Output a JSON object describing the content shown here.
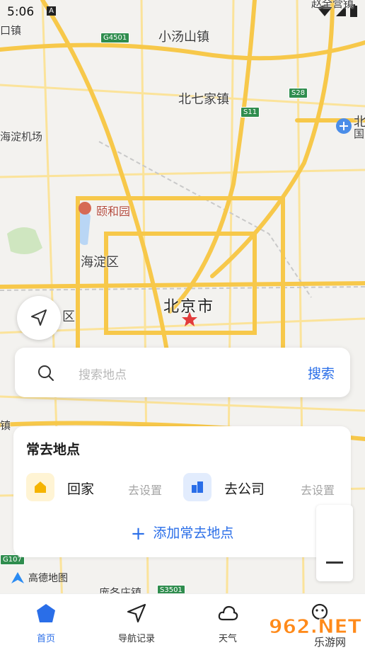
{
  "status_bar": {
    "time": "5:06",
    "app_icon": "A"
  },
  "map": {
    "labels": {
      "kou_zhen": "口镇",
      "xiaotangshan": "小汤山镇",
      "beiqijia": "北七家镇",
      "haidian_airport": "海淀机场",
      "yiheyuan": "颐和园",
      "haidian_district": "海淀区",
      "beijing_city": "北京市",
      "qu_partial": "区",
      "bei_partial": "北",
      "guo_partial": "国",
      "top_right_partial": "赵全营镇",
      "bottom_partial": "庞各庄镇",
      "zhen_partial": "镇"
    },
    "shields": {
      "g4501": "G4501",
      "s28": "S28",
      "s11": "S11",
      "g107": "G107",
      "s3501": "S3501"
    },
    "colors": {
      "road_major": "#f7c84a",
      "road_minor": "#fbe39a",
      "background": "#f3f2ef",
      "green": "#cfe6c0",
      "water": "#b9d6f5"
    }
  },
  "search": {
    "placeholder": "搜索地点",
    "button": "搜索"
  },
  "favorites": {
    "title": "常去地点",
    "home_label": "回家",
    "home_setup": "去设置",
    "work_label": "去公司",
    "work_setup": "去设置",
    "add_label": "添加常去地点"
  },
  "map_logo": "高德地图",
  "tabs": [
    {
      "label": "首页",
      "icon": "home-pentagon-icon"
    },
    {
      "label": "导航记录",
      "icon": "navigation-arrow-icon"
    },
    {
      "label": "天气",
      "icon": "cloud-icon"
    }
  ],
  "watermark": {
    "text": "962.NET",
    "sub": "乐游网"
  },
  "accent_color": "#2a6ee8"
}
